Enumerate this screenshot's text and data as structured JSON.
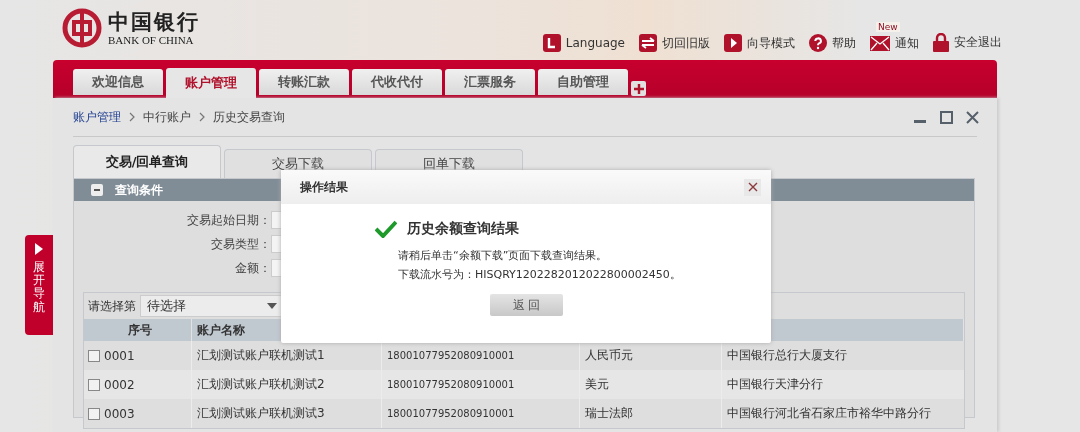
{
  "header": {
    "logo": {
      "name_cn": "中国银行",
      "name_en": "BANK OF CHINA"
    },
    "top_links": [
      {
        "kind": "language",
        "label": "Language"
      },
      {
        "kind": "switch",
        "label": "切回旧版"
      },
      {
        "kind": "guide",
        "label": "向导模式"
      },
      {
        "kind": "help",
        "label": "帮助"
      },
      {
        "kind": "notice",
        "label": "通知",
        "badge": "New"
      },
      {
        "kind": "logout",
        "label": "安全退出"
      }
    ]
  },
  "nav_tabs": [
    {
      "label": "欢迎信息",
      "selected": false
    },
    {
      "label": "账户管理",
      "selected": true
    },
    {
      "label": "转账汇款",
      "selected": false
    },
    {
      "label": "代收代付",
      "selected": false
    },
    {
      "label": "汇票服务",
      "selected": false
    },
    {
      "label": "自助管理",
      "selected": false
    }
  ],
  "breadcrumb": [
    {
      "label": "账户管理",
      "link": true
    },
    {
      "label": "中行账户",
      "link": false
    },
    {
      "label": "历史交易查询",
      "link": false
    }
  ],
  "side_nav": {
    "label": "展开导航"
  },
  "sub_tabs": [
    {
      "label": "交易/回单查询",
      "selected": true
    },
    {
      "label": "交易下载",
      "selected": false
    },
    {
      "label": "回单下载",
      "selected": false
    }
  ],
  "query_panel": {
    "title": "查询条件",
    "expanded": true,
    "fields": [
      {
        "label": "交易起始日期："
      },
      {
        "label": "交易类型："
      },
      {
        "label": "金额："
      }
    ]
  },
  "table": {
    "selector": {
      "label": "请选择第",
      "value": "待选择"
    },
    "columns": [
      "序号",
      "账户名称"
    ],
    "rows": [
      {
        "checked": false,
        "cells": [
          "0001",
          "汇划测试账户联机测试1",
          "18001077952080910001",
          "人民币元",
          "中国银行总行大厦支行"
        ]
      },
      {
        "checked": false,
        "cells": [
          "0002",
          "汇划测试账户联机测试2",
          "18001077952080910001",
          "美元",
          "中国银行天津分行"
        ]
      },
      {
        "checked": false,
        "cells": [
          "0003",
          "汇划测试账户联机测试3",
          "18001077952080910001",
          "瑞士法郎",
          "中国银行河北省石家庄市裕华中路分行"
        ]
      }
    ]
  },
  "dialog": {
    "title": "操作结果",
    "heading": "历史余额查询结果",
    "lines": [
      "请稍后单击“余额下载”页面下载查询结果。",
      "下载流水号为：HISQRY1202282012022800002450。"
    ],
    "button": "返 回"
  }
}
